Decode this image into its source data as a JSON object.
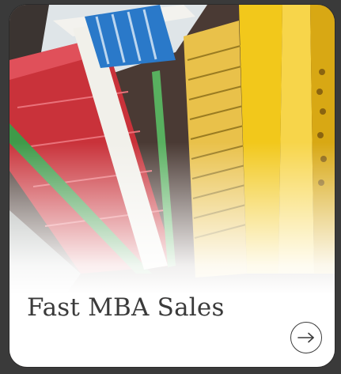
{
  "card": {
    "title": "Fast MBA Sales",
    "arrow_icon": "arrow-right-icon"
  },
  "colors": {
    "title_text": "#3a3a3a",
    "accent_yellow": "#f2c81b",
    "accent_red": "#c9323a",
    "accent_blue": "#2a79c9"
  }
}
